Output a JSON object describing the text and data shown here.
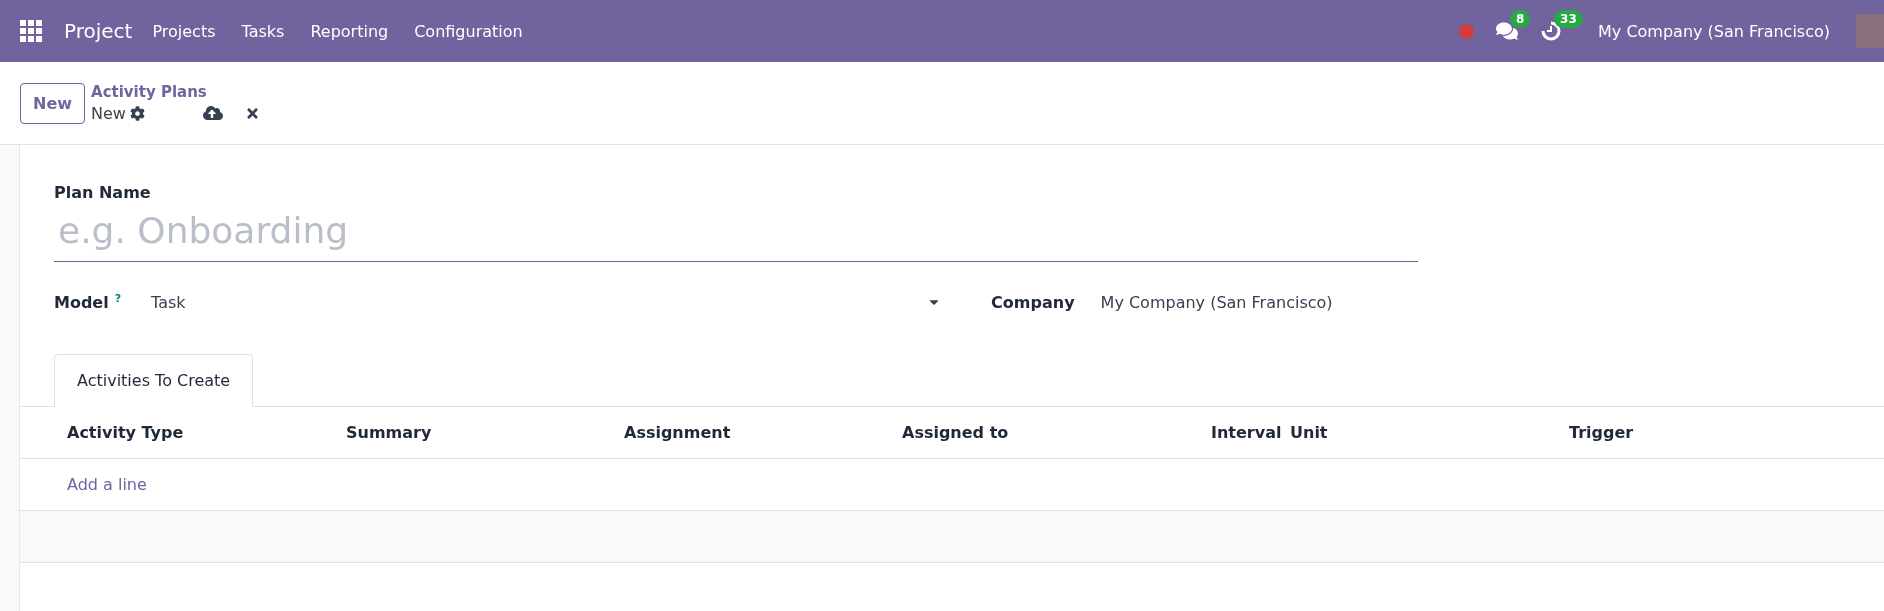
{
  "navbar": {
    "app_name": "Project",
    "menu": [
      "Projects",
      "Tasks",
      "Reporting",
      "Configuration"
    ],
    "messages_count": "8",
    "activities_count": "33",
    "company": "My Company (San Francisco)"
  },
  "control_panel": {
    "new_button": "New",
    "breadcrumb": "Activity Plans",
    "record": "New"
  },
  "form": {
    "plan_name": {
      "label": "Plan Name",
      "placeholder": "e.g. Onboarding"
    },
    "model": {
      "label": "Model",
      "help": "?",
      "value": "Task"
    },
    "company": {
      "label": "Company",
      "value": "My Company (San Francisco)"
    },
    "tabs": [
      {
        "label": "Activities To Create",
        "selected": true
      }
    ],
    "table": {
      "columns": [
        "Activity Type",
        "Summary",
        "Assignment",
        "Assigned to",
        "Interval",
        "Unit",
        "Trigger"
      ],
      "add_line": "Add a line"
    }
  }
}
